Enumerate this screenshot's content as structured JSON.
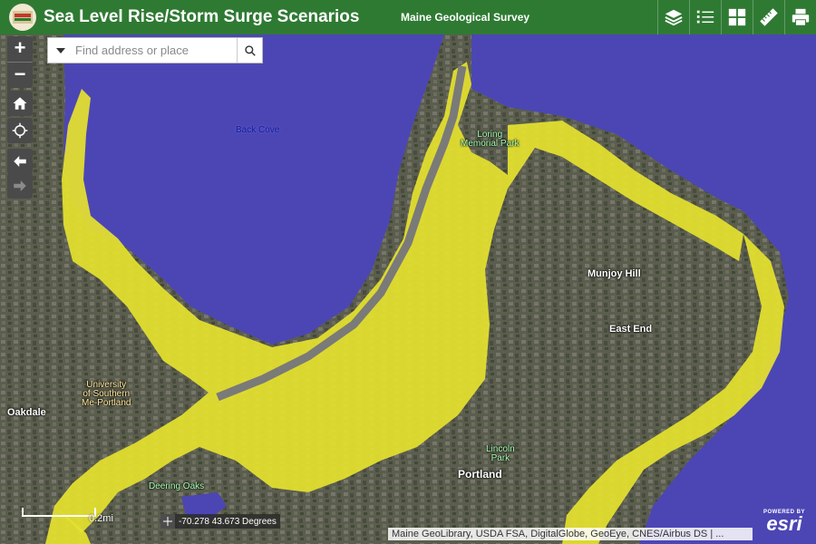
{
  "header": {
    "title": "Sea Level Rise/Storm Surge Scenarios",
    "subtitle": "Maine Geological Survey",
    "tools": [
      "layers-icon",
      "legend-icon",
      "basemap-gallery-icon",
      "measure-icon",
      "print-icon"
    ]
  },
  "search": {
    "placeholder": "Find address or place"
  },
  "map_labels": {
    "back_cove": "Back Cove",
    "loring_park": "Loring\nMemorial Park",
    "munjoy_hill": "Munjoy Hill",
    "east_end": "East End",
    "university": "University\nof Southern\nMe-Portland",
    "oakdale": "Oakdale",
    "lincoln_park": "Lincoln\nPark",
    "portland": "Portland",
    "deering_oaks": "Deering Oaks"
  },
  "scale": {
    "label": "0.2mi"
  },
  "coordinates": {
    "text": "-70.278 43.673 Degrees"
  },
  "attribution": "Maine GeoLibrary, USDA FSA, DigitalGlobe, GeoEye, CNES/Airbus DS | ...",
  "esri": {
    "powered": "POWERED BY",
    "brand": "esri"
  },
  "colors": {
    "header": "#2f7a33",
    "water": "#4c46b5",
    "inundation": "#e6e22f",
    "land": "#5a5c4c"
  }
}
